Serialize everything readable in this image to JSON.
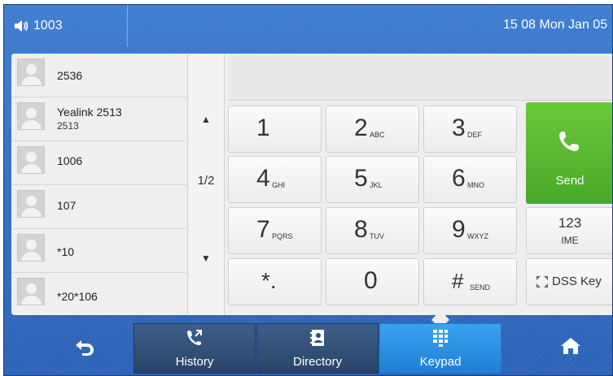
{
  "status_bar": {
    "line_icon": "speaker-icon",
    "line_label": "1003",
    "clock": "15 08 Mon Jan 05"
  },
  "history": [
    {
      "name": "2536",
      "number": ""
    },
    {
      "name": "Yealink 2513",
      "number": "2513"
    },
    {
      "name": "1006",
      "number": ""
    },
    {
      "name": "107",
      "number": ""
    },
    {
      "name": "*10",
      "number": ""
    },
    {
      "name": "*20*106",
      "number": ""
    }
  ],
  "pager": {
    "up": "▲",
    "page": "1/2",
    "down": "▼"
  },
  "number_input": {
    "value": ""
  },
  "keypad": {
    "k1": {
      "main": "1",
      "sub": ""
    },
    "k2": {
      "main": "2",
      "sub": "ABC"
    },
    "k3": {
      "main": "3",
      "sub": "DEF"
    },
    "k4": {
      "main": "4",
      "sub": "GHI"
    },
    "k5": {
      "main": "5",
      "sub": "JKL"
    },
    "k6": {
      "main": "6",
      "sub": "MNO"
    },
    "k7": {
      "main": "7",
      "sub": "PQRS"
    },
    "k8": {
      "main": "8",
      "sub": "TUV"
    },
    "k9": {
      "main": "9",
      "sub": "WXYZ"
    },
    "kstar": {
      "main": "*.",
      "sub": ""
    },
    "k0": {
      "main": "0",
      "sub": ""
    },
    "khash": {
      "main": "#",
      "sub": "SEND"
    }
  },
  "send_button": {
    "label": "Send",
    "color": "#58b830"
  },
  "ime_button": {
    "line1": "123",
    "line2": "IME"
  },
  "dss_button": {
    "label": "DSS Key"
  },
  "bottom_nav": {
    "back_icon": "back-arrow-icon",
    "home_icon": "home-icon",
    "tabs": [
      {
        "label": "History",
        "icon": "history-phone-icon"
      },
      {
        "label": "Directory",
        "icon": "directory-book-icon"
      },
      {
        "label": "Keypad",
        "icon": "keypad-grid-icon"
      }
    ],
    "active_tab": "Keypad"
  },
  "colors": {
    "header_blue": "#3a76c9",
    "active_tab": "#2a8de2",
    "send_green": "#58b830"
  }
}
